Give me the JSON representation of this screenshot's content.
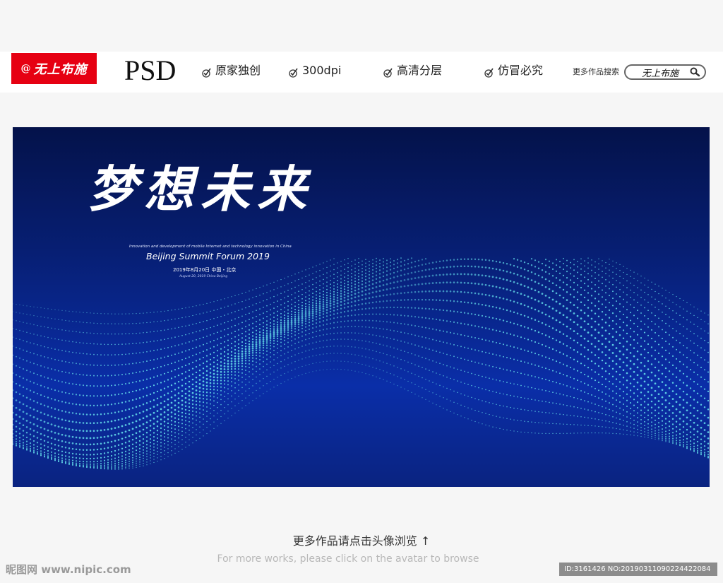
{
  "header": {
    "logo_text": "无上布施",
    "logo_at": "@",
    "format_label": "PSD",
    "features": [
      {
        "label": "原家独创",
        "icon": "check-icon"
      },
      {
        "label": "300dpi",
        "icon": "check-icon"
      },
      {
        "label": "高清分层",
        "icon": "check-icon"
      },
      {
        "label": "仿冒必究",
        "icon": "check-icon"
      }
    ],
    "search_label": "更多作品搜索",
    "search_value": "无上布施",
    "search_icon": "search-icon",
    "colors": {
      "logo_bg": "#e60012"
    }
  },
  "banner": {
    "title": "梦想未来",
    "subtitle": "Innovation and development of mobile Internet and technology innovation in China",
    "forum": "Beijing Summit Forum 2019",
    "date_cn": "2019年8月20日 中国・北京",
    "date_en": "August 20, 2019 China Beijing",
    "colors": {
      "bg_top": "#04124a",
      "bg_bottom": "#0a2ea8",
      "wave": "#5fd3e6"
    }
  },
  "footer": {
    "more_cn": "更多作品请点击头像浏览 ↑",
    "more_en": "For more works, please click on the avatar to browse",
    "watermark": "昵图网 www.nipic.com",
    "id_text": "ID:3161426 NO:20190311090224422084"
  }
}
